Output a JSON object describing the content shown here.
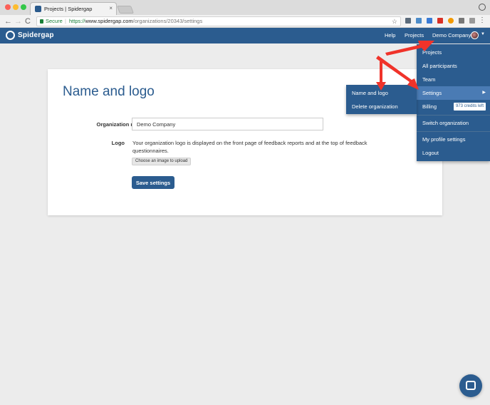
{
  "browser": {
    "tab_title": "Projects | Spidergap",
    "tab_close": "×",
    "secure_label": "Secure",
    "url_protocol": "https://",
    "url_host": "www.spidergap.com",
    "url_path": "/organizations/20343/settings",
    "back": "←",
    "forward": "→",
    "reload": "C",
    "star": "☆",
    "menu": "⋮"
  },
  "appbar": {
    "logo": "Spidergap",
    "help": "Help",
    "projects": "Projects",
    "company": "Demo Company",
    "caret": "▼"
  },
  "page": {
    "title": "Name and logo",
    "org_label": "Organization name",
    "org_value": "Demo Company",
    "logo_label": "Logo",
    "logo_help": "Your organization logo is displayed on the front page of feedback reports and at the top of feedback questionnaires.",
    "upload_label": "Choose an image to upload",
    "save_label": "Save settings"
  },
  "dropdown": {
    "items": [
      {
        "label": "Projects"
      },
      {
        "label": "All participants"
      },
      {
        "label": "Team"
      },
      {
        "label": "Settings",
        "arrow": "▶"
      },
      {
        "label": "Billing",
        "badge": "973 credits left"
      },
      {
        "label": "Switch organization"
      },
      {
        "label": "My profile settings"
      },
      {
        "label": "Logout"
      }
    ]
  },
  "submenu": {
    "items": [
      {
        "label": "Name and logo"
      },
      {
        "label": "Delete organization"
      }
    ]
  },
  "colors": {
    "brand": "#2b5c8f",
    "active": "#4a7bb4",
    "annotation": "#f0332a"
  }
}
